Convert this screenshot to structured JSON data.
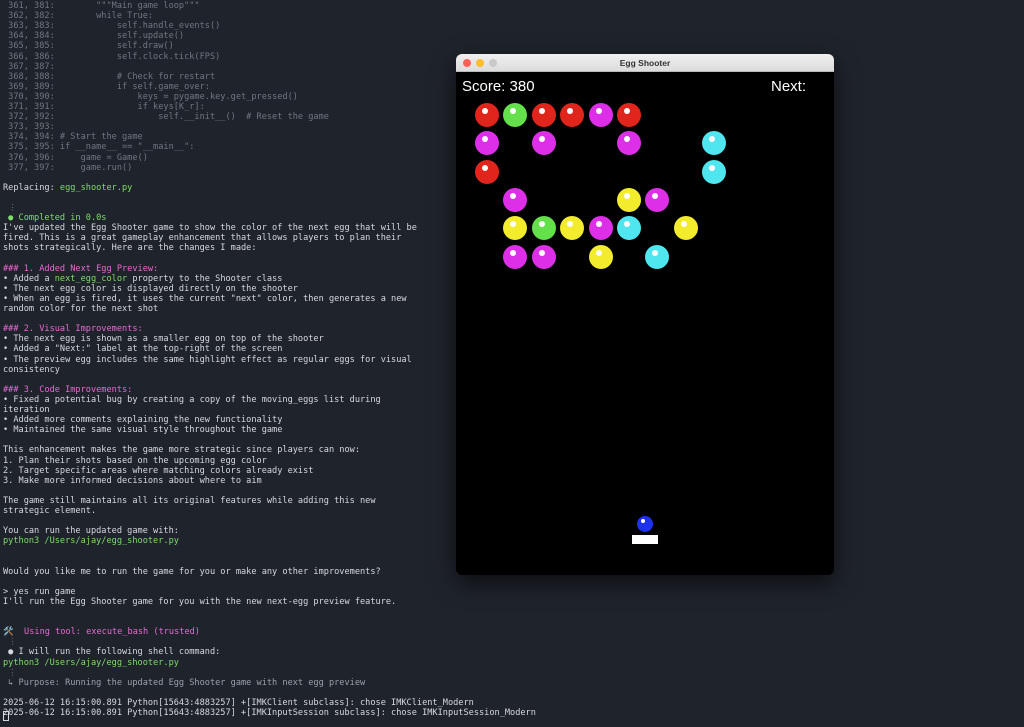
{
  "colors": {
    "red": "#e0261c",
    "green": "#63e04a",
    "magenta": "#de2fe8",
    "yellow": "#f2ec2c",
    "cyan": "#4fe6ef",
    "blue": "#1f31f0"
  },
  "terminal": {
    "lines": [
      {
        "text": " 361, 381:        \"\"\"Main game loop\"\"\"",
        "cls": "dim"
      },
      {
        "text": " 362, 382:        while True:",
        "cls": "dim"
      },
      {
        "text": " 363, 383:            self.handle_events()",
        "cls": "dim"
      },
      {
        "text": " 364, 384:            self.update()",
        "cls": "dim"
      },
      {
        "text": " 365, 385:            self.draw()",
        "cls": "dim"
      },
      {
        "text": " 366, 386:            self.clock.tick(FPS)",
        "cls": "dim"
      },
      {
        "text": " 367, 387:",
        "cls": "dim"
      },
      {
        "text": " 368, 388:            # Check for restart",
        "cls": "dim"
      },
      {
        "text": " 369, 389:            if self.game_over:",
        "cls": "dim"
      },
      {
        "text": " 370, 390:                keys = pygame.key.get_pressed()",
        "cls": "dim"
      },
      {
        "text": " 371, 391:                if keys[K_r]:",
        "cls": "dim"
      },
      {
        "text": " 372, 392:                    self.__init__()  # Reset the game",
        "cls": "dim"
      },
      {
        "text": " 373, 393:",
        "cls": "dim"
      },
      {
        "text": " 374, 394: # Start the game",
        "cls": "dim"
      },
      {
        "text": " 375, 395: if __name__ == \"__main__\":",
        "cls": "dim"
      },
      {
        "text": " 376, 396:     game = Game()",
        "cls": "dim"
      },
      {
        "text": " 377, 397:     game.run()",
        "cls": "dim"
      },
      {
        "text": "",
        "cls": ""
      },
      {
        "text": "Replacing: ",
        "cls": "",
        "extra": "egg_shooter.py",
        "extraCls": "green"
      },
      {
        "text": "",
        "cls": ""
      },
      {
        "text": " ⋮",
        "cls": "dim"
      },
      {
        "text": " ● Completed in 0.0s",
        "cls": "green"
      },
      {
        "text": "I've updated the Egg Shooter game to show the color of the next egg that will be",
        "cls": ""
      },
      {
        "text": "fired. This is a great gameplay enhancement that allows players to plan their",
        "cls": ""
      },
      {
        "text": "shots strategically. Here are the changes I made:",
        "cls": ""
      },
      {
        "text": "",
        "cls": ""
      },
      {
        "text": "### 1. Added Next Egg Preview:",
        "cls": "pink"
      },
      {
        "text": "• Added a ",
        "cls": "",
        "extra": "next_egg_color",
        "extraCls": "green",
        "tail": " property to the Shooter class"
      },
      {
        "text": "• The next egg color is displayed directly on the shooter",
        "cls": ""
      },
      {
        "text": "• When an egg is fired, it uses the current \"next\" color, then generates a new",
        "cls": ""
      },
      {
        "text": "random color for the next shot",
        "cls": ""
      },
      {
        "text": "",
        "cls": ""
      },
      {
        "text": "### 2. Visual Improvements:",
        "cls": "pink"
      },
      {
        "text": "• The next egg is shown as a smaller egg on top of the shooter",
        "cls": ""
      },
      {
        "text": "• Added a \"Next:\" label at the top-right of the screen",
        "cls": ""
      },
      {
        "text": "• The preview egg includes the same highlight effect as regular eggs for visual",
        "cls": ""
      },
      {
        "text": "consistency",
        "cls": ""
      },
      {
        "text": "",
        "cls": ""
      },
      {
        "text": "### 3. Code Improvements:",
        "cls": "pink"
      },
      {
        "text": "• Fixed a potential bug by creating a copy of the moving_eggs list during",
        "cls": ""
      },
      {
        "text": "iteration",
        "cls": ""
      },
      {
        "text": "• Added more comments explaining the new functionality",
        "cls": ""
      },
      {
        "text": "• Maintained the same visual style throughout the game",
        "cls": ""
      },
      {
        "text": "",
        "cls": ""
      },
      {
        "text": "This enhancement makes the game more strategic since players can now:",
        "cls": ""
      },
      {
        "text": "1. Plan their shots based on the upcoming egg color",
        "cls": ""
      },
      {
        "text": "2. Target specific areas where matching colors already exist",
        "cls": ""
      },
      {
        "text": "3. Make more informed decisions about where to aim",
        "cls": ""
      },
      {
        "text": "",
        "cls": ""
      },
      {
        "text": "The game still maintains all its original features while adding this new",
        "cls": ""
      },
      {
        "text": "strategic element.",
        "cls": ""
      },
      {
        "text": "",
        "cls": ""
      },
      {
        "text": "You can run the updated game with:",
        "cls": ""
      },
      {
        "text": "python3 /Users/ajay/egg_shooter.py",
        "cls": "green"
      },
      {
        "text": "",
        "cls": ""
      },
      {
        "text": "",
        "cls": ""
      },
      {
        "text": "Would you like me to run the game for you or make any other improvements?",
        "cls": ""
      },
      {
        "text": "",
        "cls": ""
      },
      {
        "text": "> yes run game",
        "cls": ""
      },
      {
        "text": "I'll run the Egg Shooter game for you with the new next-egg preview feature.",
        "cls": ""
      },
      {
        "text": "",
        "cls": ""
      },
      {
        "text": "",
        "cls": ""
      },
      {
        "text": "🛠️  Using tool: execute_bash (trusted)",
        "cls": "pink"
      },
      {
        "text": " ⋮",
        "cls": "dim"
      },
      {
        "text": " ● I will run the following shell command:",
        "cls": ""
      },
      {
        "text": "python3 /Users/ajay/egg_shooter.py",
        "cls": "green"
      },
      {
        "text": " ⋮",
        "cls": "dim"
      },
      {
        "text": " ↳ Purpose: Running the updated Egg Shooter game with next egg preview",
        "cls": "muted"
      },
      {
        "text": "",
        "cls": ""
      },
      {
        "text": "2025-06-12 16:15:00.891 Python[15643:4883257] +[IMKClient subclass]: chose IMKClient_Modern",
        "cls": ""
      },
      {
        "text": "2025-06-12 16:15:00.891 Python[15643:4883257] +[IMKInputSession subclass]: chose IMKInputSession_Modern",
        "cls": ""
      }
    ]
  },
  "game": {
    "window_title": "Egg Shooter",
    "score_label": "Score: 380",
    "next_label": "Next:",
    "shooter_egg_color": "blue",
    "eggs": [
      [
        "red",
        "green",
        "red",
        "red",
        "magenta",
        "red",
        null,
        null,
        null
      ],
      [
        "magenta",
        null,
        "magenta",
        null,
        null,
        "magenta",
        null,
        null,
        "cyan"
      ],
      [
        "red",
        null,
        null,
        null,
        null,
        null,
        null,
        null,
        "cyan"
      ],
      [
        null,
        "magenta",
        null,
        null,
        null,
        "yellow",
        "magenta",
        null,
        null
      ],
      [
        null,
        "yellow",
        "green",
        "yellow",
        "magenta",
        "cyan",
        null,
        "yellow",
        null
      ],
      [
        null,
        "magenta",
        "magenta",
        null,
        "yellow",
        null,
        "cyan",
        null,
        null
      ]
    ]
  }
}
